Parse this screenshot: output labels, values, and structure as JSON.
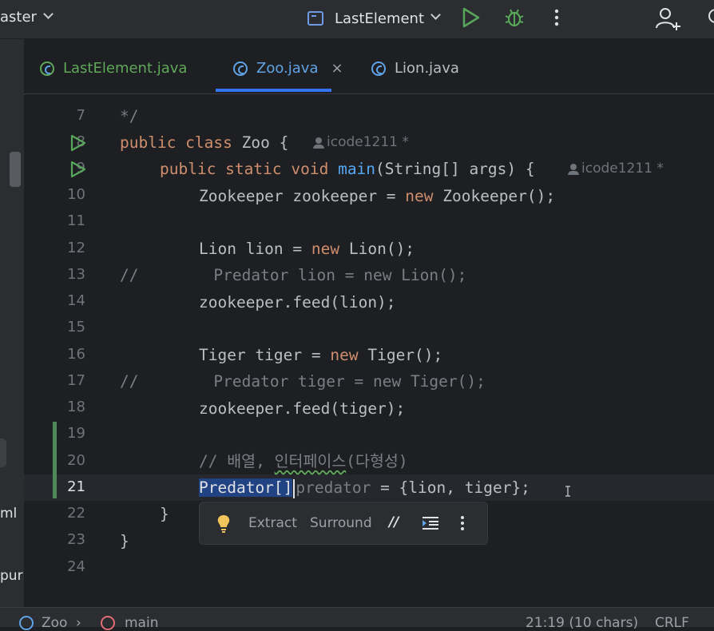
{
  "toolbar": {
    "branch": "master",
    "branch_visible": "aster",
    "run_config": "LastElement",
    "icons": [
      "run-icon",
      "debug-icon",
      "more-icon",
      "add-user-icon"
    ]
  },
  "tabs": [
    {
      "label": "LastElement.java",
      "color": "#5fa85a",
      "active": false
    },
    {
      "label": "Zoo.java",
      "color": "#5fa3e6",
      "active": true,
      "close": "×"
    },
    {
      "label": "Lion.java",
      "color": "#bcbec4",
      "active": false
    }
  ],
  "editor": {
    "line_numbers": [
      "7",
      "8",
      "9",
      "10",
      "11",
      "12",
      "13",
      "14",
      "15",
      "16",
      "17",
      "18",
      "19",
      "20",
      "21",
      "22",
      "23",
      "24"
    ],
    "current_line": "21",
    "lines": {
      "l7": "*/",
      "l8_kw": "public class",
      "l8_name": "Zoo {",
      "l9_kw": "public static void",
      "l9_fn": "main",
      "l9_rest": "(String[] args) {",
      "l10_a": "Zookeeper zookeeper = ",
      "l10_kw": "new",
      "l10_b": " Zookeeper();",
      "l12_a": "Lion lion = ",
      "l12_kw": "new",
      "l12_b": " Lion();",
      "l13": "//        Predator lion = new Lion();",
      "l14": "zookeeper.feed(lion);",
      "l16_a": "Tiger tiger = ",
      "l16_kw": "new",
      "l16_b": " Tiger();",
      "l17": "//        Predator tiger = new Tiger();",
      "l18": "zookeeper.feed(tiger);",
      "l20_a": "// 배열, ",
      "l20_b": "인터페이스",
      "l20_c": "(다형성)",
      "l21_sel": "Predator[]",
      "l21_var": "predator",
      "l21_rest": " = {lion, tiger};",
      "l22": "}",
      "l23": "}"
    },
    "author_hint_1": "icode1211 *",
    "author_hint_2": "icode1211 *"
  },
  "popup": {
    "extract": "Extract",
    "surround": "Surround",
    "comment": "//"
  },
  "statusbar": {
    "breadcrumb_1": "Zoo",
    "breadcrumb_2": "main",
    "position": "21:19 (10 chars)",
    "line_ending": "CRLF"
  },
  "left_panel_fragments": [
    "ml",
    "pur"
  ],
  "colors": {
    "keyword": "#cf8e6d",
    "function": "#56a8f5",
    "comment": "#7a7e85",
    "selection": "#214283",
    "run_green": "#58a55c",
    "accent": "#3574f0"
  }
}
